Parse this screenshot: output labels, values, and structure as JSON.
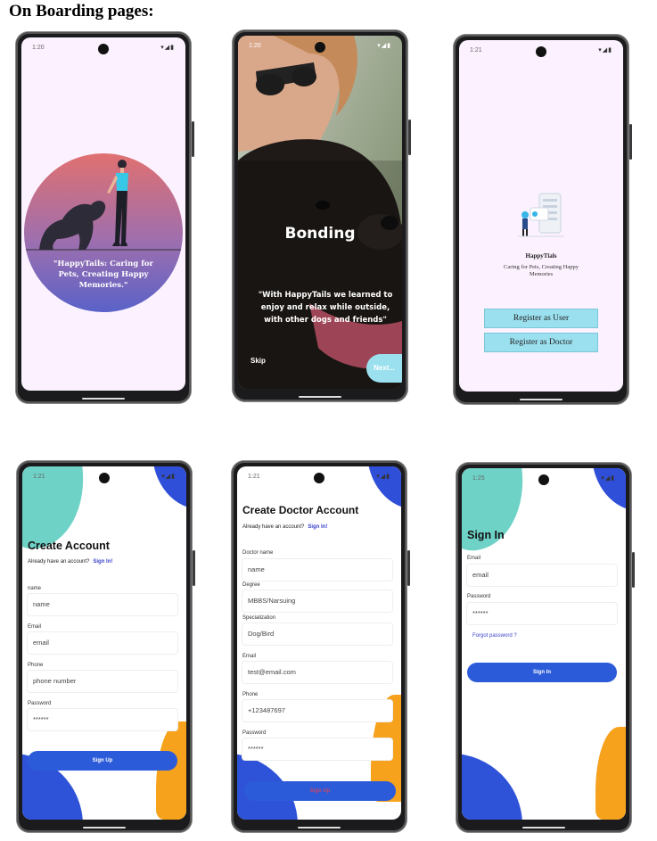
{
  "document": {
    "title": "On Boarding pages:"
  },
  "colors": {
    "teal": "#6fd2c7",
    "blue": "#2f53d8",
    "orange": "#f6a21c",
    "primary_button": "#2c5bd9",
    "lavender_bg": "#fcf2ff",
    "sky_button": "#9be0ef"
  },
  "screen1": {
    "time": "1:20",
    "status_icons": "▾◢▮",
    "quote": "\"HappyTails: Caring for Pets, Creating Happy Memories.\""
  },
  "screen2": {
    "time": "1:20",
    "status_icons": "▾◢▮",
    "heading": "Bonding",
    "quote": "\"With HappyTails we learned to enjoy and relax while outside, with other dogs and friends\"",
    "skip_label": "Skip",
    "next_label": "Next..."
  },
  "screen3": {
    "time": "1:21",
    "status_icons": "▾◢▮",
    "app_name": "HappyTials",
    "tagline": "Caring for Pets, Creating Happy Memories",
    "register_user_label": "Register as User",
    "register_doctor_label": "Register as Doctor"
  },
  "screen4": {
    "time": "1:21",
    "status_icons": "▾◢▮",
    "title": "Create Account",
    "have_account": "Already have an account?",
    "sign_in_link": "Sign In!",
    "fields": [
      {
        "label": "name",
        "value": "name"
      },
      {
        "label": "Email",
        "value": "email"
      },
      {
        "label": "Phone",
        "value": "phone number"
      },
      {
        "label": "Password",
        "value": "******"
      }
    ],
    "signup_label": "Sign Up"
  },
  "screen5": {
    "time": "1:21",
    "status_icons": "▾◢▮",
    "title": "Create Doctor Account",
    "have_account": "Already have an account?",
    "sign_in_link": "Sign In!",
    "fields": [
      {
        "label": "Doctor name",
        "value": "name"
      },
      {
        "label": "Degree",
        "value": "MBBS/Narsuing"
      },
      {
        "label": "Specialization",
        "value": "Dog/Bird"
      },
      {
        "label": "Email",
        "value": "test@email.com"
      },
      {
        "label": "Phone",
        "value": "+123487697"
      },
      {
        "label": "Password",
        "value": "******"
      }
    ],
    "signup_label": "Sign Up"
  },
  "screen6": {
    "time": "1:25",
    "status_icons": "▾◢▮",
    "title": "Sign In",
    "fields": [
      {
        "label": "Email",
        "value": "email"
      },
      {
        "label": "Password",
        "value": "******"
      }
    ],
    "forgot_label": "Forgot password ?",
    "signin_label": "Sign In"
  }
}
